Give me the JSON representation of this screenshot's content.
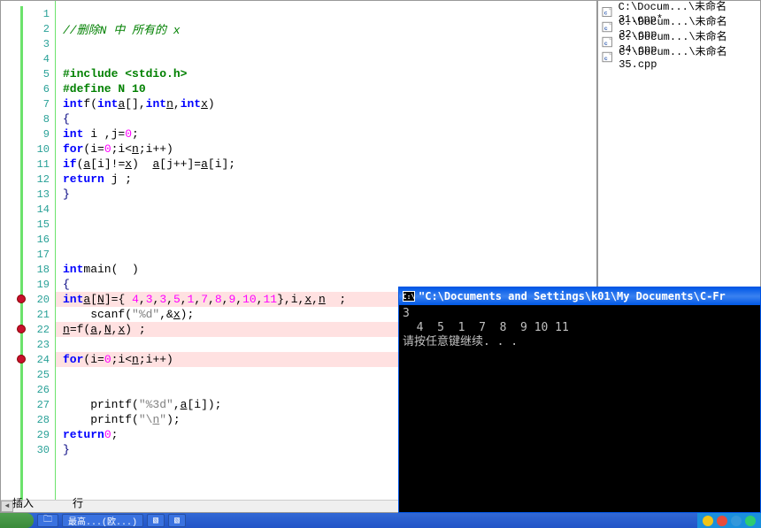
{
  "editor": {
    "lines": [
      {
        "n": 1,
        "type": "blank"
      },
      {
        "n": 2,
        "type": "comment",
        "text": "//删除N 中 所有的 x"
      },
      {
        "n": 3,
        "type": "blank"
      },
      {
        "n": 4,
        "type": "blank"
      },
      {
        "n": 5,
        "type": "pre",
        "text": "#include <stdio.h>"
      },
      {
        "n": 6,
        "type": "pre",
        "text": "#define N 10"
      },
      {
        "n": 7,
        "type": "funcdecl",
        "kw": "int",
        "name": "f",
        "params": "(int a[],int n,int x)"
      },
      {
        "n": 8,
        "type": "brace",
        "text": "{"
      },
      {
        "n": 9,
        "type": "code",
        "indent": 1,
        "html": "int i ,j=0;"
      },
      {
        "n": 10,
        "type": "code",
        "indent": 1,
        "html": "for(i=0;i<n;i++)"
      },
      {
        "n": 11,
        "type": "code",
        "indent": 1,
        "html": "if(a[i]!=x)  a[j++]=a[i];"
      },
      {
        "n": 12,
        "type": "code",
        "indent": 1,
        "html": "return j ;"
      },
      {
        "n": 13,
        "type": "brace",
        "text": "}"
      },
      {
        "n": 14,
        "type": "blank"
      },
      {
        "n": 15,
        "type": "blank"
      },
      {
        "n": 16,
        "type": "blank"
      },
      {
        "n": 17,
        "type": "blank"
      },
      {
        "n": 18,
        "type": "funcdecl",
        "kw": "int",
        "name": "main",
        "params": "(  )"
      },
      {
        "n": 19,
        "type": "brace",
        "text": "{"
      },
      {
        "n": 20,
        "type": "code",
        "indent": 1,
        "hl": true,
        "bp": true,
        "html": "int a[N]={ 4,3,3,5,1,7,8,9,10,11},i,x,n  ;"
      },
      {
        "n": 21,
        "type": "code",
        "indent": 1,
        "html": "scanf(\"%d\",&x);"
      },
      {
        "n": 22,
        "type": "code",
        "indent": 1,
        "hl": true,
        "bp": true,
        "html": "n=f(a,N,x) ;"
      },
      {
        "n": 23,
        "type": "blank"
      },
      {
        "n": 24,
        "type": "code",
        "indent": 1,
        "hl": true,
        "bp": true,
        "html": "for(i=0;i<n;i++)"
      },
      {
        "n": 25,
        "type": "blank"
      },
      {
        "n": 26,
        "type": "blank"
      },
      {
        "n": 27,
        "type": "code",
        "indent": 1,
        "html": "printf(\"%3d\",a[i]);"
      },
      {
        "n": 28,
        "type": "code",
        "indent": 1,
        "html": "printf(\"\\n\");"
      },
      {
        "n": 29,
        "type": "code",
        "indent": 1,
        "html": "return 0;"
      },
      {
        "n": 30,
        "type": "brace",
        "text": "}"
      }
    ]
  },
  "side_files": [
    {
      "path": "C:\\Docum...\\未命名31.cpp*"
    },
    {
      "path": "C:\\Docum...\\未命名32.cpp"
    },
    {
      "path": "C:\\Docum...\\未命名34.cpp"
    },
    {
      "path": "C:\\Docum...\\未命名35.cpp"
    }
  ],
  "console": {
    "title": "\"C:\\Documents and Settings\\k01\\My Documents\\C-Fr",
    "line1": "3",
    "line2": "  4  5  1  7  8  9 10 11",
    "line3": "请按任意键继续. . ."
  },
  "status": {
    "mode": "插入",
    "col_label": "行"
  },
  "taskbar": {
    "item1": "",
    "item2": "最高...(欧...)"
  }
}
